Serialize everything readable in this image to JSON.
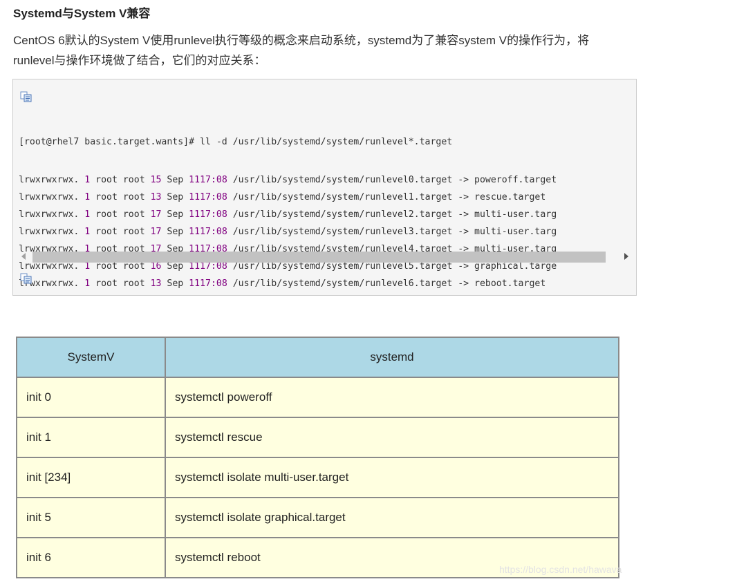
{
  "heading": "Systemd与System V兼容",
  "paragraph": "CentOS 6默认的System V使用runlevel执行等级的概念来启动系统，systemd为了兼容system V的操作行为，将runlevel与操作环境做了结合，它们的对应关系：",
  "code": {
    "copy_icon": "copy-icon",
    "prompt_line": "[root@rhel7 basic.target.wants]# ll -d /usr/lib/systemd/system/runlevel*.target",
    "lines": [
      {
        "perm": "lrwxrwxrwx. ",
        "links": "1",
        "owner": " root root ",
        "size": "15",
        "mon": " Sep ",
        "day": "11",
        "time": "17:08",
        "path": " /usr/lib/systemd/system/runlevel0.target -> poweroff.target"
      },
      {
        "perm": "lrwxrwxrwx. ",
        "links": "1",
        "owner": " root root ",
        "size": "13",
        "mon": " Sep ",
        "day": "11",
        "time": "17:08",
        "path": " /usr/lib/systemd/system/runlevel1.target -> rescue.target"
      },
      {
        "perm": "lrwxrwxrwx. ",
        "links": "1",
        "owner": " root root ",
        "size": "17",
        "mon": " Sep ",
        "day": "11",
        "time": "17:08",
        "path": " /usr/lib/systemd/system/runlevel2.target -> multi-user.targ"
      },
      {
        "perm": "lrwxrwxrwx. ",
        "links": "1",
        "owner": " root root ",
        "size": "17",
        "mon": " Sep ",
        "day": "11",
        "time": "17:08",
        "path": " /usr/lib/systemd/system/runlevel3.target -> multi-user.targ"
      },
      {
        "perm": "lrwxrwxrwx. ",
        "links": "1",
        "owner": " root root ",
        "size": "17",
        "mon": " Sep ",
        "day": "11",
        "time": "17:08",
        "path": " /usr/lib/systemd/system/runlevel4.target -> multi-user.targ"
      },
      {
        "perm": "lrwxrwxrwx. ",
        "links": "1",
        "owner": " root root ",
        "size": "16",
        "mon": " Sep ",
        "day": "11",
        "time": "17:08",
        "path": " /usr/lib/systemd/system/runlevel5.target -> graphical.targe"
      },
      {
        "perm": "lrwxrwxrwx. ",
        "links": "1",
        "owner": " root root ",
        "size": "13",
        "mon": " Sep ",
        "day": "11",
        "time": "17:08",
        "path": " /usr/lib/systemd/system/runlevel6.target -> reboot.target"
      }
    ]
  },
  "table": {
    "headers": [
      "SystemV",
      "systemd"
    ],
    "rows": [
      [
        "init 0",
        "systemctl poweroff"
      ],
      [
        "init 1",
        "systemctl rescue"
      ],
      [
        "init [234]",
        "systemctl isolate multi-user.target"
      ],
      [
        "init 5",
        "systemctl isolate graphical.target"
      ],
      [
        "init 6",
        "systemctl reboot"
      ]
    ]
  },
  "watermark": "https://blog.csdn.net/hawava",
  "colors": {
    "number_highlight": "#800080",
    "table_header_bg": "#add8e6",
    "table_cell_bg": "#ffffe0"
  }
}
